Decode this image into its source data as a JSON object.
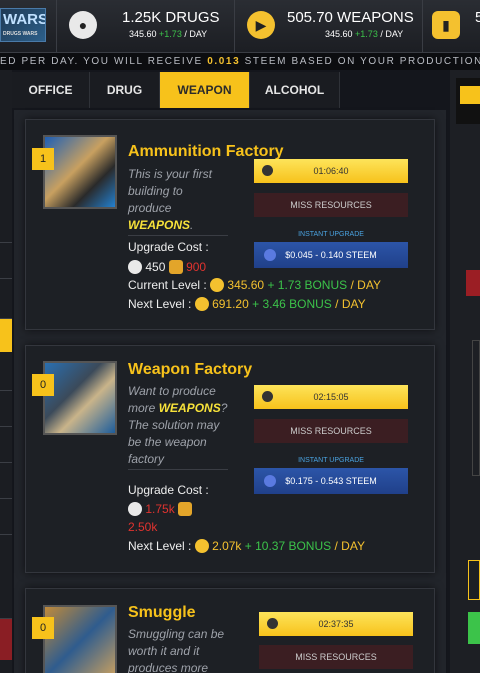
{
  "header": {
    "logo_text": "WARS",
    "logo_sub": "DRUGS WARS",
    "drugs": {
      "amount": "1.25K DRUGS",
      "rate": "345.60",
      "bonus": "+1.73",
      "unit": "/ DAY",
      "icon": "pill-icon"
    },
    "weapons": {
      "amount": "505.70 WEAPONS",
      "rate": "345.60",
      "bonus": "+1.73",
      "unit": "/ DAY",
      "icon": "gun-icon"
    },
    "alcohol": {
      "amount": "5",
      "icon": "bottle-icon"
    }
  },
  "ticker": {
    "prefix": "ED PER DAY. YOU WILL RECEIVE ",
    "value": "0.013",
    "suffix": " STEEM BASED ON YOUR PRODUCTION"
  },
  "tabs": [
    {
      "label": "OFFICE"
    },
    {
      "label": "DRUG"
    },
    {
      "label": "WEAPON",
      "active": true
    },
    {
      "label": "ALCOHOL"
    }
  ],
  "cards": [
    {
      "level": "1",
      "title": "Ammunition Factory",
      "desc_pre": "This is your first building to produce",
      "desc_em": "WEAPONS",
      "desc_post": ".",
      "timer": "01:06:40",
      "miss": "MISS RESOURCES",
      "instant_label": "INSTANT UPGRADE",
      "instant": "$0.045 - 0.140 STEEM",
      "upgrade_label": "Upgrade Cost :",
      "cost_a": "450",
      "cost_b": "900",
      "current_label": "Current Level :",
      "current_value": "345.60",
      "current_bonus": "+ 1.73 BONUS",
      "current_unit": "/ DAY",
      "next_label": "Next Level :",
      "next_value": "691.20",
      "next_bonus": "+ 3.46 BONUS",
      "next_unit": "/ DAY"
    },
    {
      "level": "0",
      "title": "Weapon Factory",
      "desc_pre": "Want to produce more",
      "desc_em": "WEAPONS",
      "desc_post": "? The solution may be the weapon factory",
      "timer": "02:15:05",
      "miss": "MISS RESOURCES",
      "instant_label": "INSTANT UPGRADE",
      "instant": "$0.175 - 0.543 STEEM",
      "upgrade_label": "Upgrade Cost :",
      "cost_a": "1.75k",
      "cost_b": "2.50k",
      "next_label": "Next Level :",
      "next_value": "2.07k",
      "next_bonus": "+ 10.37 BONUS",
      "next_unit": "/ DAY"
    },
    {
      "level": "0",
      "title": "Smuggle",
      "desc": "Smuggling can be worth it and it produces more",
      "timer": "02:37:35",
      "miss": "MISS RESOURCES"
    }
  ],
  "colors": {
    "accent": "#f7c21b",
    "bonus": "#3cc34a",
    "cost_red": "#e0332f",
    "steem_blue": "#2c55a8"
  }
}
